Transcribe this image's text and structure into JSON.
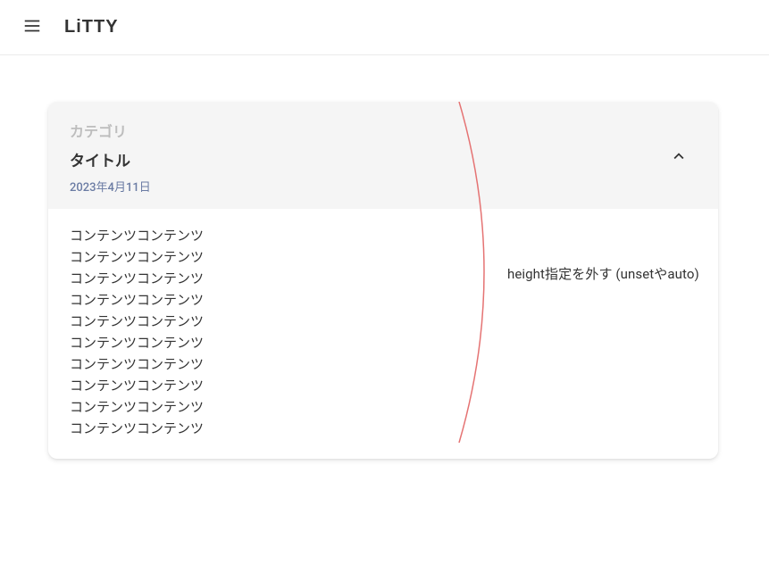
{
  "app": {
    "logo": "LiTTY"
  },
  "card": {
    "category": "カテゴリ",
    "title": "タイトル",
    "date": "2023年4月11日",
    "content_lines": [
      "コンテンツコンテンツ",
      "コンテンツコンテンツ",
      "コンテンツコンテンツ",
      "コンテンツコンテンツ",
      "コンテンツコンテンツ",
      "コンテンツコンテンツ",
      "コンテンツコンテンツ",
      "コンテンツコンテンツ",
      "コンテンツコンテンツ",
      "コンテンツコンテンツ"
    ]
  },
  "annotation": {
    "text": "height指定を外す (unsetやauto)",
    "stroke": "#e57373"
  }
}
